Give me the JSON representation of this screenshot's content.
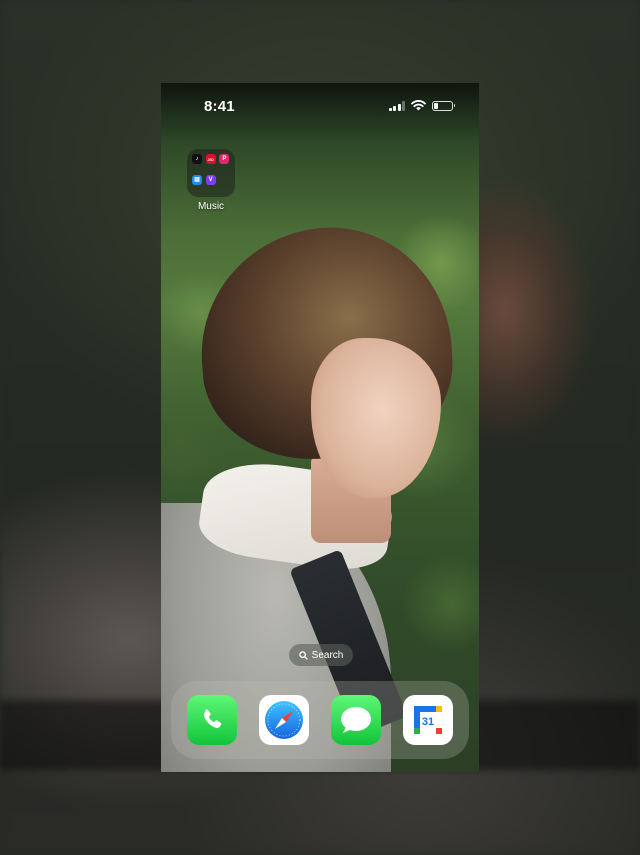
{
  "status_bar": {
    "time": "8:41",
    "signal_bars": 3,
    "battery_level_percent": 25
  },
  "home": {
    "folder": {
      "label": "Music",
      "apps": [
        {
          "icon": "tiktok-icon",
          "glyph": "♪",
          "color": "#111111"
        },
        {
          "icon": "jiosaavn-icon",
          "glyph": "JIO",
          "color": "#d8112a"
        },
        {
          "icon": "pocketfm-icon",
          "glyph": "P",
          "color": "#e8246b"
        },
        {
          "icon": "files-icon",
          "glyph": "▤",
          "color": "#1d8cf0"
        },
        {
          "icon": "vlog-icon",
          "glyph": "V",
          "color": "#7b3ff2"
        }
      ]
    },
    "search": {
      "label": "Search"
    }
  },
  "dock": {
    "apps": [
      {
        "name": "phone",
        "icon": "phone-icon"
      },
      {
        "name": "safari",
        "icon": "safari-compass-icon"
      },
      {
        "name": "messages",
        "icon": "messages-bubble-icon"
      },
      {
        "name": "calendar",
        "icon": "calendar-icon",
        "date": "31"
      }
    ]
  },
  "colors": {
    "accent_green": "#12c43a",
    "calendar_blue": "#1a73e8",
    "safari_blue": "#1e90ff"
  }
}
